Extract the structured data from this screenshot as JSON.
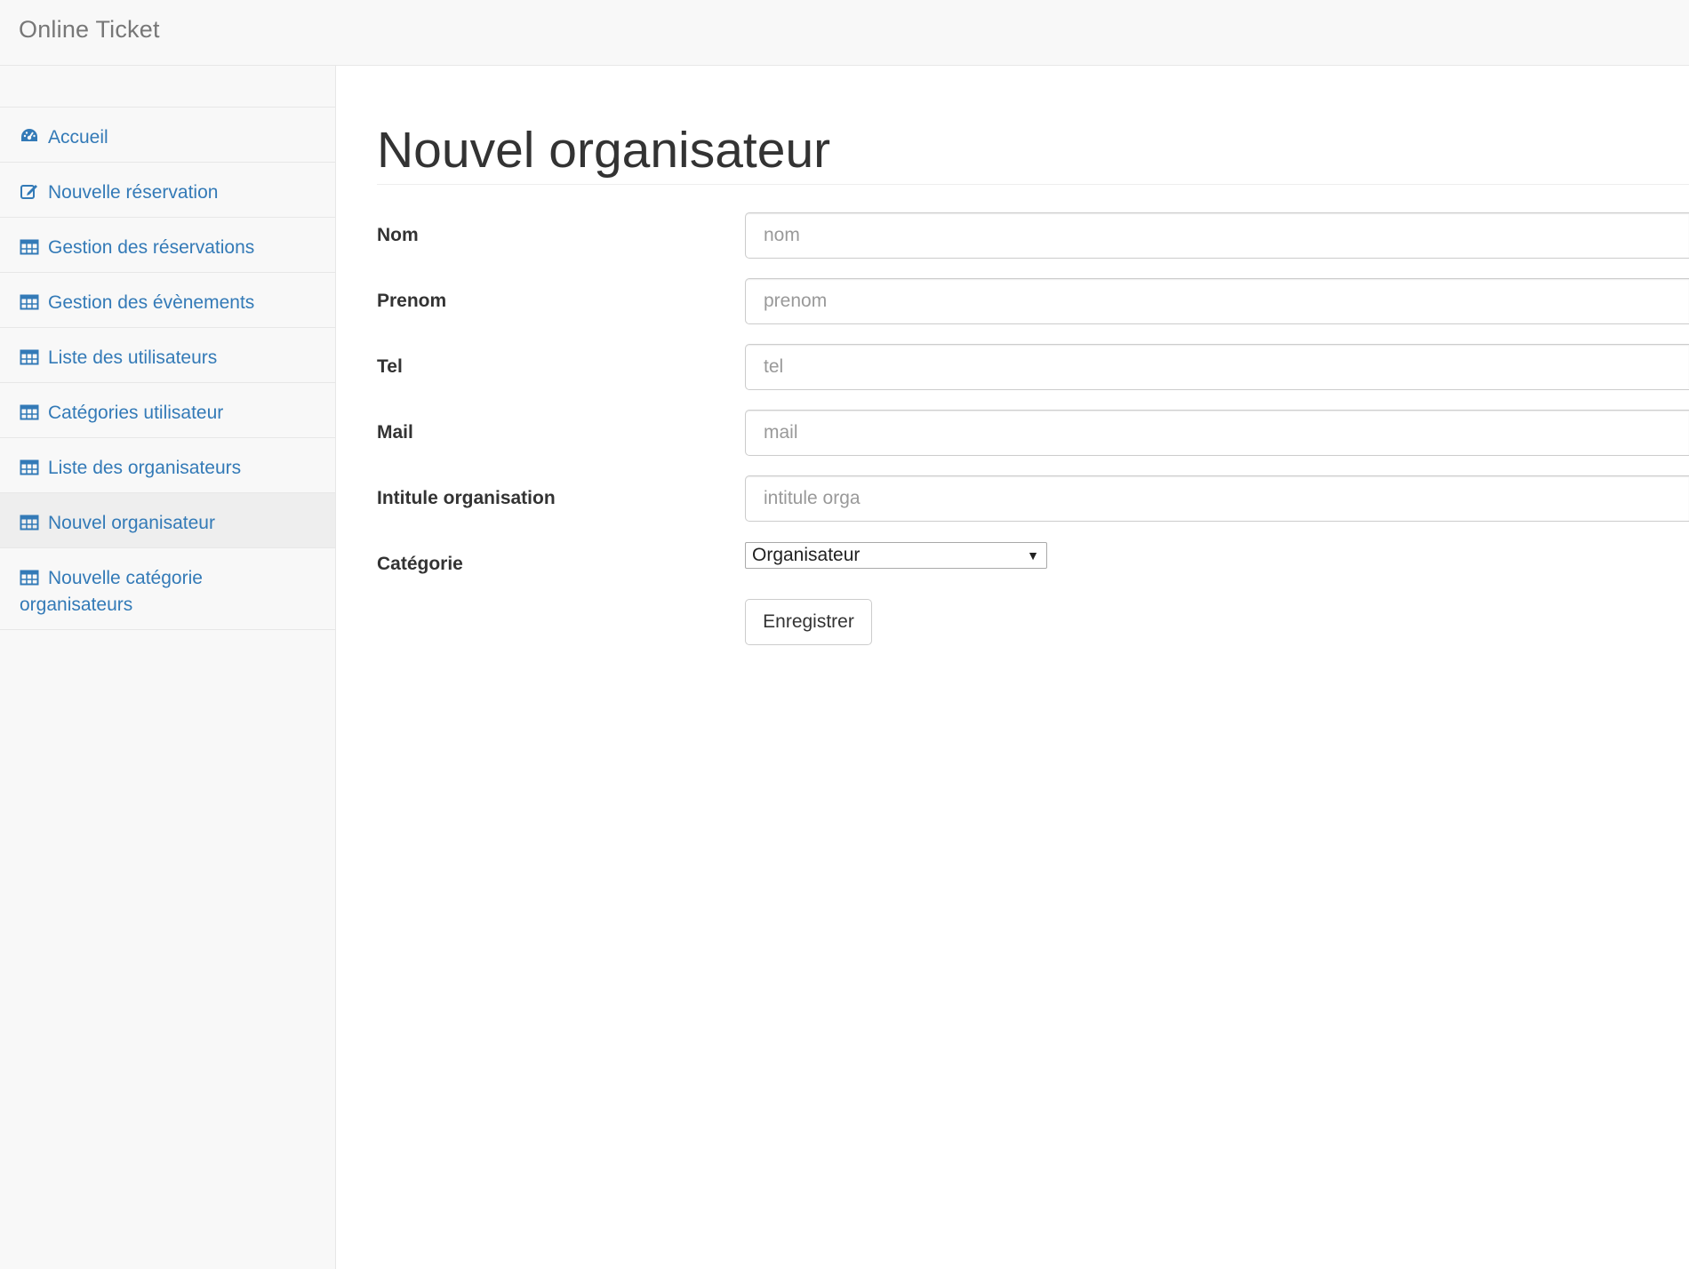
{
  "app": {
    "brand": "Online Ticket"
  },
  "sidebar": {
    "items": [
      {
        "label": "Accueil",
        "icon": "dashboard-icon"
      },
      {
        "label": "Nouvelle réservation",
        "icon": "edit-icon"
      },
      {
        "label": "Gestion des réservations",
        "icon": "table-icon"
      },
      {
        "label": "Gestion des évènements",
        "icon": "table-icon"
      },
      {
        "label": "Liste des utilisateurs",
        "icon": "table-icon"
      },
      {
        "label": "Catégories utilisateur",
        "icon": "table-icon"
      },
      {
        "label": "Liste des organisateurs",
        "icon": "table-icon"
      },
      {
        "label": "Nouvel organisateur",
        "icon": "table-icon",
        "active": true
      },
      {
        "label": "Nouvelle catégorie organisateurs",
        "icon": "table-icon"
      }
    ]
  },
  "main": {
    "title": "Nouvel organisateur",
    "form": {
      "nom": {
        "label": "Nom",
        "placeholder": "nom",
        "value": ""
      },
      "prenom": {
        "label": "Prenom",
        "placeholder": "prenom",
        "value": ""
      },
      "tel": {
        "label": "Tel",
        "placeholder": "tel",
        "value": ""
      },
      "mail": {
        "label": "Mail",
        "placeholder": "mail",
        "value": ""
      },
      "intitule": {
        "label": "Intitule organisation",
        "placeholder": "intitule orga",
        "value": ""
      },
      "categorie": {
        "label": "Catégorie",
        "selected": "Organisateur"
      },
      "submit_label": "Enregistrer"
    }
  },
  "colors": {
    "link": "#337ab7",
    "navbar_bg": "#f8f8f8",
    "active_bg": "#eeeeee",
    "brand_text": "#777777"
  }
}
